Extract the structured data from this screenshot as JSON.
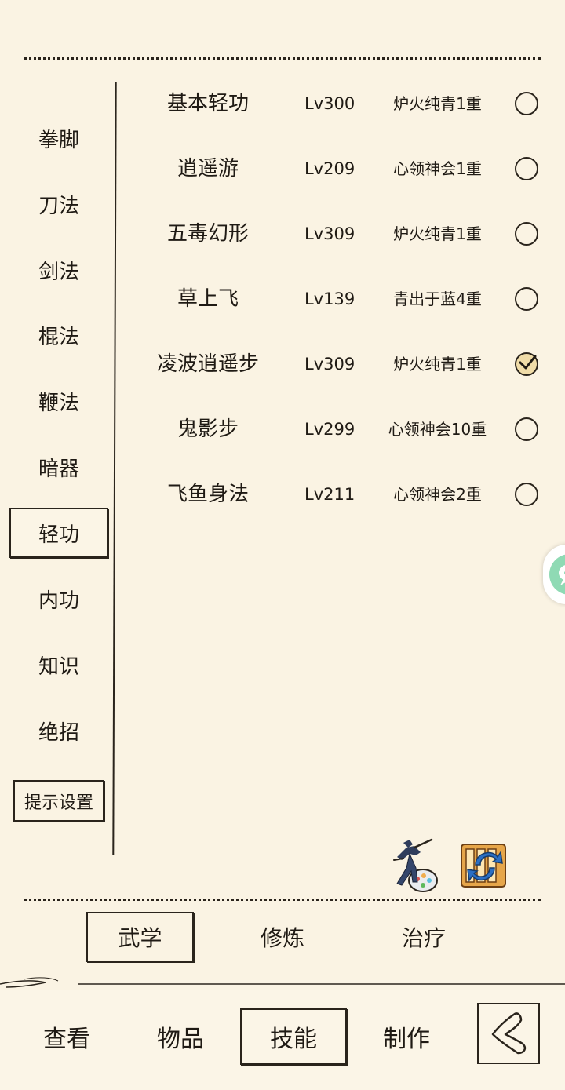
{
  "categories": [
    {
      "label": "拳脚"
    },
    {
      "label": "刀法"
    },
    {
      "label": "剑法"
    },
    {
      "label": "棍法"
    },
    {
      "label": "鞭法"
    },
    {
      "label": "暗器"
    },
    {
      "label": "轻功",
      "selected": true
    },
    {
      "label": "内功"
    },
    {
      "label": "知识"
    },
    {
      "label": "绝招"
    }
  ],
  "hint_settings_label": "提示设置",
  "skills": [
    {
      "name": "基本轻功",
      "level": "Lv300",
      "realm": "炉火纯青1重",
      "checked": false
    },
    {
      "name": "逍遥游",
      "level": "Lv209",
      "realm": "心领神会1重",
      "checked": false
    },
    {
      "name": "五毒幻形",
      "level": "Lv309",
      "realm": "炉火纯青1重",
      "checked": false
    },
    {
      "name": "草上飞",
      "level": "Lv139",
      "realm": "青出于蓝4重",
      "checked": false
    },
    {
      "name": "凌波逍遥步",
      "level": "Lv309",
      "realm": "炉火纯青1重",
      "checked": true
    },
    {
      "name": "鬼影步",
      "level": "Lv299",
      "realm": "心领神会10重",
      "checked": false
    },
    {
      "name": "飞鱼身法",
      "level": "Lv211",
      "realm": "心领神会2重",
      "checked": false
    }
  ],
  "action_icons": [
    "martial-figure-icon",
    "scroll-book-icon"
  ],
  "subtabs": [
    {
      "label": "武学",
      "selected": true
    },
    {
      "label": "修炼"
    },
    {
      "label": "治疗"
    }
  ],
  "nav_tabs": [
    {
      "label": "查看"
    },
    {
      "label": "物品"
    },
    {
      "label": "技能",
      "selected": true
    },
    {
      "label": "制作"
    }
  ],
  "back_icon": "back-arrow-icon",
  "chat_icon": "chat-bubble-icon",
  "colors": {
    "background": "#faf3e3",
    "ink": "#2a241c",
    "checked_fill": "#f0dca8",
    "chat_green": "#8fdab4"
  }
}
